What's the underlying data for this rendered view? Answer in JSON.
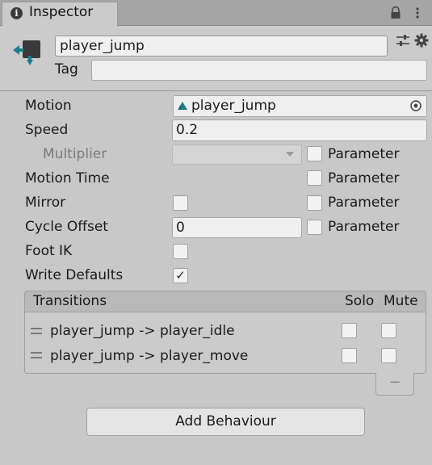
{
  "window": {
    "tab_title": "Inspector",
    "icons": [
      "info-icon",
      "lock-icon",
      "menu-icon"
    ]
  },
  "header": {
    "object_name": "player_jump",
    "tag_label": "Tag",
    "tag_value": "",
    "icons": [
      "animator-state-icon",
      "sliders-icon",
      "gear-icon"
    ]
  },
  "properties": {
    "motion": {
      "label": "Motion",
      "value": "player_jump"
    },
    "speed": {
      "label": "Speed",
      "value": "0.2"
    },
    "multiplier": {
      "label": "Multiplier",
      "value": "",
      "param_label": "Parameter",
      "param_checked": false
    },
    "motion_time": {
      "label": "Motion Time",
      "param_label": "Parameter",
      "param_checked": false
    },
    "mirror": {
      "label": "Mirror",
      "checked": false,
      "param_label": "Parameter",
      "param_checked": false
    },
    "cycle_offset": {
      "label": "Cycle Offset",
      "value": "0",
      "param_label": "Parameter",
      "param_checked": false
    },
    "foot_ik": {
      "label": "Foot IK",
      "checked": false
    },
    "write_defaults": {
      "label": "Write Defaults",
      "checked": true,
      "check_glyph": "✓"
    }
  },
  "transitions": {
    "header": "Transitions",
    "solo_label": "Solo",
    "mute_label": "Mute",
    "items": [
      {
        "label": "player_jump -> player_idle",
        "solo": false,
        "mute": false
      },
      {
        "label": "player_jump -> player_move",
        "solo": false,
        "mute": false
      }
    ],
    "remove_label": "−"
  },
  "add_behaviour_label": "Add Behaviour",
  "colors": {
    "panel_bg": "#c8c8c8",
    "tab_bar_bg": "#a5a5a5",
    "field_bg": "#efefef",
    "icon_teal": "#1b7f8c"
  }
}
